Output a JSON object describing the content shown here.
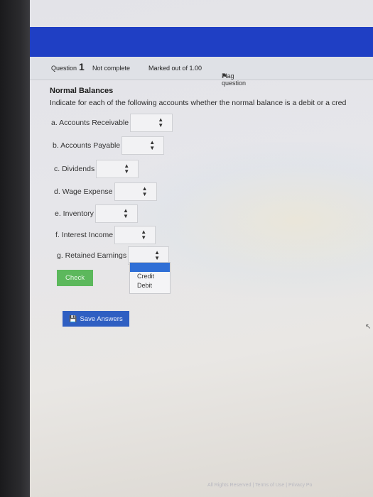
{
  "header": {
    "question_label": "Question",
    "question_number": "1",
    "status": "Not complete",
    "marks": "Marked out of 1.00",
    "flag_label": "Flag question"
  },
  "question": {
    "title": "Normal Balances",
    "instruction": "Indicate for each of the following accounts whether the normal balance is a debit or a cred",
    "items": [
      {
        "label": "a. Accounts Receivable"
      },
      {
        "label": "b. Accounts Payable"
      },
      {
        "label": "c. Dividends"
      },
      {
        "label": "d. Wage Expense"
      },
      {
        "label": "e. Inventory"
      },
      {
        "label": "f. Interest Income"
      },
      {
        "label": "g. Retained Earnings"
      }
    ],
    "dropdown_options": [
      "Credit",
      "Debit"
    ]
  },
  "buttons": {
    "check": "Check",
    "save": "Save Answers"
  },
  "footer": {
    "text": "All Rights Reserved | Terms of Use | Privacy Po"
  },
  "colors": {
    "topbar": "#1f3fc4",
    "check_button": "#5cb85c",
    "save_button": "#2f5fc2",
    "dropdown_highlight": "#2f6fd6"
  }
}
